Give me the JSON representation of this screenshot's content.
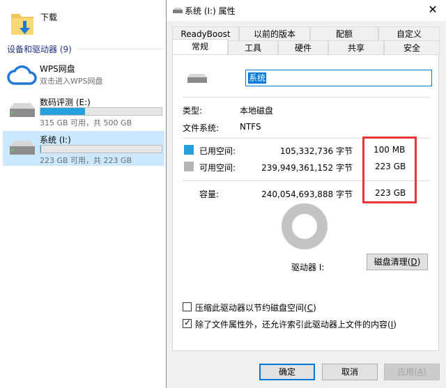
{
  "explorer": {
    "downloads_label": "下载",
    "group_header": "设备和驱动器 (9)",
    "drives": [
      {
        "name": "WPS网盘",
        "sub": "双击进入WPS网盘"
      },
      {
        "name": "数码评测 (E:)",
        "sub": "315 GB 可用，共 500 GB",
        "used_fraction": 0.37
      },
      {
        "name": "系统 (I:)",
        "sub": "223 GB 可用，共 223 GB",
        "used_fraction": 0.001
      }
    ]
  },
  "dialog": {
    "title": "系统 (I:) 属性",
    "tabs_back": [
      "ReadyBoost",
      "以前的版本",
      "配额",
      "自定义"
    ],
    "tabs_front": [
      "常规",
      "工具",
      "硬件",
      "共享",
      "安全"
    ],
    "active_tab": "常规",
    "name_value": "系统",
    "type_label": "类型:",
    "type_value": "本地磁盘",
    "fs_label": "文件系统:",
    "fs_value": "NTFS",
    "used_label": "已用空间:",
    "used_bytes": "105,332,736 字节",
    "used_size": "100 MB",
    "free_label": "可用空间:",
    "free_bytes": "239,949,361,152 字节",
    "free_size": "223 GB",
    "capacity_label": "容量:",
    "capacity_bytes": "240,054,693,888 字节",
    "capacity_size": "223 GB",
    "drive_label": "驱动器 I:",
    "cleanup_label": "磁盘清理(",
    "cleanup_key": "D",
    "compress_label": "压缩此驱动器以节约磁盘空间(",
    "compress_key": "C",
    "index_label": "除了文件属性外，还允许索引此驱动器上文件的内容(",
    "index_key": "I",
    "ok_label": "确定",
    "cancel_label": "取消",
    "apply_label": "应用(",
    "apply_key": "A",
    "close_glyph": "✕",
    "colors": {
      "used": "#26a0da",
      "free": "#b4b4b4",
      "annotation": "#e8343a",
      "accent": "#0078d7"
    }
  }
}
